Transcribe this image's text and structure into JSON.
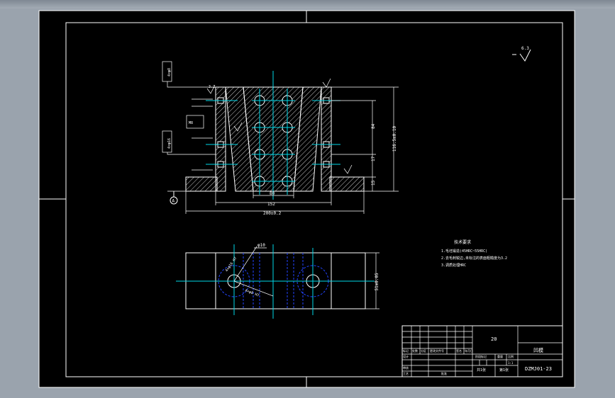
{
  "tech": {
    "heading": "技术要求",
    "req1": "1.毛坯锻造(45HRC~55HRC)",
    "req2": "2.去毛刺锐边,未标注的表面粗糙度为3.2",
    "req3": "3.调质处理HRC"
  },
  "dims": {
    "total_height": "116.5±0.10",
    "h_84": "84",
    "h_17": "17",
    "h_15": "15",
    "w_152": "152",
    "w_200": "200±0.2",
    "w_80": "80",
    "dia_10": "φ10",
    "hole_a": "4×φ16 H7",
    "hole_b": "4×φ8 H7",
    "width_side": "51±0.05"
  },
  "surface": {
    "ra_global": "6.3",
    "ra_local": "3.2"
  },
  "datum": {
    "label": "A"
  },
  "title_block": {
    "qty": "20",
    "part_name": "凹模",
    "drawing_no": "DZMJ01-23",
    "material_hint": "比例",
    "labels": [
      "标记",
      "处数",
      "分区",
      "更改文件号",
      "签名",
      "年月日"
    ],
    "row_design": "设计",
    "row_check": "审核",
    "row_process": "工艺",
    "row_approve": "批准",
    "stage_label": "阶段标记",
    "weight_label": "重量",
    "scale_label": "比例",
    "scale_value": "1:1",
    "sheet_total": "共1张",
    "sheet_no": "第1张"
  }
}
